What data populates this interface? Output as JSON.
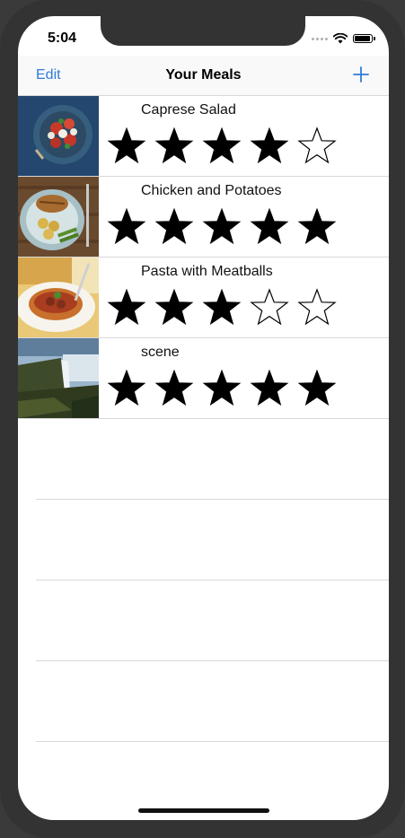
{
  "status_bar": {
    "time": "5:04"
  },
  "nav": {
    "edit_label": "Edit",
    "title": "Your Meals",
    "add_icon": "plus-icon",
    "accent": "#2f7bd9"
  },
  "meals": [
    {
      "name": "Caprese Salad",
      "rating": 4,
      "max_rating": 5,
      "thumb_icon": "caprese-salad-photo"
    },
    {
      "name": "Chicken and Potatoes",
      "rating": 5,
      "max_rating": 5,
      "thumb_icon": "chicken-potatoes-photo"
    },
    {
      "name": "Pasta with Meatballs",
      "rating": 3,
      "max_rating": 5,
      "thumb_icon": "pasta-meatballs-photo"
    },
    {
      "name": "scene",
      "rating": 5,
      "max_rating": 5,
      "thumb_icon": "waterfall-landscape-photo"
    }
  ]
}
